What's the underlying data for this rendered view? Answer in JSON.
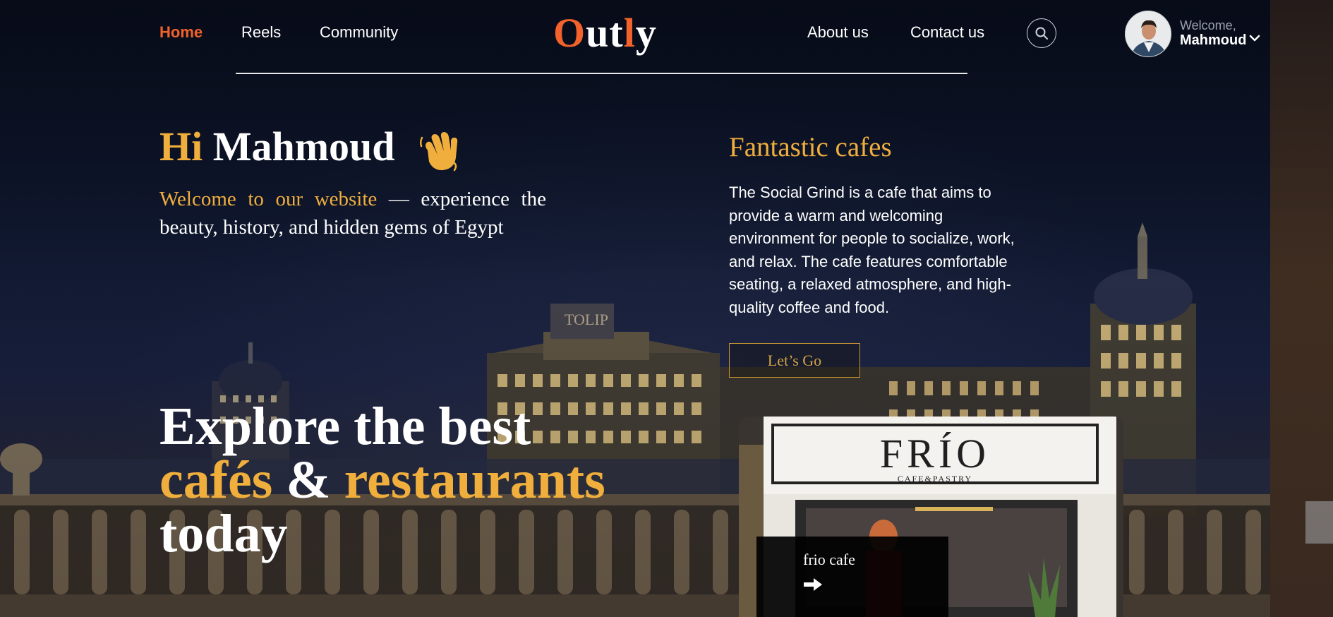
{
  "header": {
    "nav_left": [
      "Home",
      "Reels",
      "Community"
    ],
    "nav_right": [
      "About us",
      "Contact us"
    ],
    "logo": {
      "part1": "O",
      "part2": "ut",
      "part3": "l",
      "part4": "y"
    },
    "user": {
      "greeting": "Welcome,",
      "name": "Mahmoud"
    },
    "icons": {
      "search": "search-icon",
      "dropdown": "chevron-down-icon"
    }
  },
  "hero": {
    "hi_word": "Hi",
    "hi_name": "Mahmoud",
    "wave_icon": "waving-hand-icon",
    "intro_highlight": "Welcome to our website",
    "intro_rest": " — experience the beauty, history, and hidden gems of Egypt",
    "explore_line1": "Explore the best",
    "explore_gold1": "cafés",
    "explore_amp": " & ",
    "explore_gold2": "restaurants",
    "explore_line3": "today"
  },
  "feature": {
    "title": "Fantastic cafes",
    "description": "The Social Grind is a cafe that aims to provide a warm and welcoming environment for people to socialize, work, and relax. The cafe features comfortable seating, a relaxed atmosphere, and high-quality coffee and food.",
    "button": "Let’s Go"
  },
  "card": {
    "sign_main": "FRÍO",
    "sign_sub": "CAFE&PASTRY",
    "name": "frio cafe",
    "arrow_icon": "arrow-right-icon"
  },
  "colors": {
    "accent_orange": "#f2622a",
    "accent_gold": "#f0ae3d",
    "button_border": "#c99532"
  }
}
